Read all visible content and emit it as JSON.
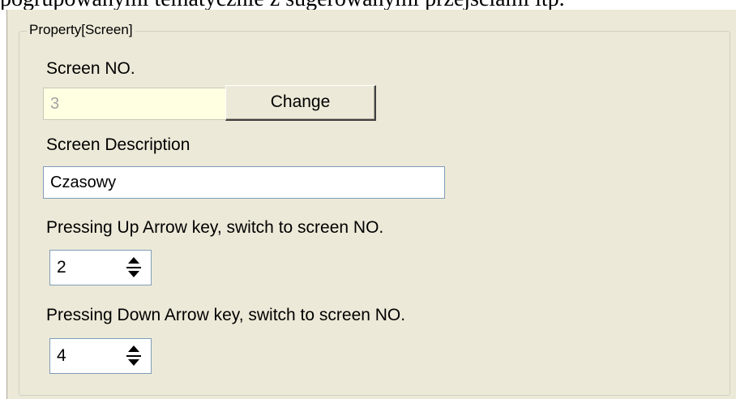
{
  "document": {
    "top_text": "pogrupowanymi tematycznie z sugerowanymi przejściami itp."
  },
  "group": {
    "title": "Property[Screen]"
  },
  "screen_no": {
    "label": "Screen NO.",
    "value": "3",
    "change_label": "Change"
  },
  "screen_description": {
    "label": "Screen Description",
    "value": "Czasowy"
  },
  "up_arrow": {
    "label": "Pressing Up Arrow key, switch to screen NO.",
    "value": "2"
  },
  "down_arrow": {
    "label": "Pressing Down Arrow key, switch to screen NO.",
    "value": "4"
  },
  "colors": {
    "dialog_bg": "#ece9d8",
    "readonly_bg": "#ffffe1",
    "input_border": "#7f9db9"
  }
}
